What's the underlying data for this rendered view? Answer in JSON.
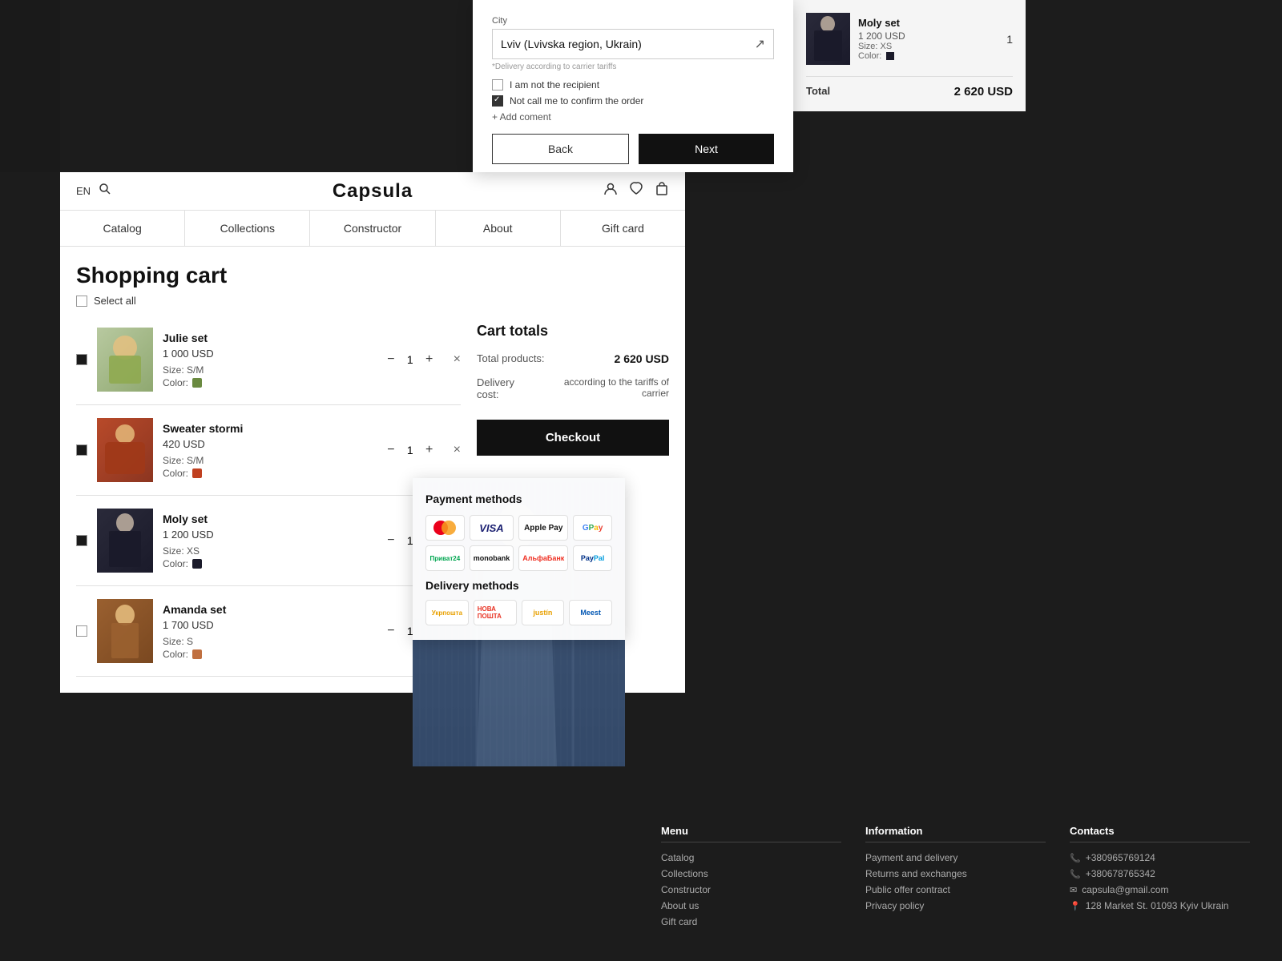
{
  "brand": "Capsula",
  "header": {
    "lang": "EN",
    "nav": [
      {
        "label": "Catalog"
      },
      {
        "label": "Collections"
      },
      {
        "label": "Constructor"
      },
      {
        "label": "About"
      },
      {
        "label": "Gift card"
      }
    ]
  },
  "page": {
    "title": "Shopping cart",
    "select_all": "Select all"
  },
  "cart_items": [
    {
      "name": "Julie set",
      "price": "1 000 USD",
      "size": "Size: S/M",
      "color_label": "Color:",
      "color": "#6a8a40",
      "qty": "1",
      "checked": true,
      "img_class": "cart-item-img-green"
    },
    {
      "name": "Sweater stormi",
      "price": "420 USD",
      "size": "Size: S/M",
      "color_label": "Color:",
      "color": "#c04020",
      "qty": "1",
      "checked": true,
      "img_class": "cart-item-img-rust"
    },
    {
      "name": "Moly set",
      "price": "1 200 USD",
      "size": "Size: XS",
      "color_label": "Color:",
      "color": "#1a1a2a",
      "qty": "1",
      "checked": true,
      "img_class": "cart-item-img-dark"
    },
    {
      "name": "Amanda set",
      "price": "1 700 USD",
      "size": "Size: S",
      "color_label": "Color:",
      "color": "#c07040",
      "qty": "1",
      "checked": false,
      "img_class": "cart-item-img-brown"
    }
  ],
  "cart_totals": {
    "title": "Cart totals",
    "total_products_label": "Total products:",
    "total_products_value": "2 620 USD",
    "delivery_label": "Delivery cost:",
    "delivery_value": "according to the tariffs of carrier",
    "checkout_btn": "Checkout"
  },
  "checkout_form": {
    "city_label": "City",
    "city_value": "Lviv (Lvivska region, Ukrain)",
    "delivery_note": "*Delivery according to carrier tariffs",
    "checkbox1": "I am not the recipient",
    "checkbox2": "Not call me to confirm the order",
    "add_comment": "+ Add coment",
    "back_btn": "Back",
    "next_btn": "Next"
  },
  "order_summary": {
    "item_name": "Moly set",
    "item_price": "1 200 USD",
    "item_size": "Size: XS",
    "item_color": "Color:",
    "item_qty": "1",
    "total_label": "Total",
    "total_value": "2 620 USD"
  },
  "footer": {
    "menu_title": "Menu",
    "menu_items": [
      "Catalog",
      "Collections",
      "Constructor",
      "About us",
      "Gift card"
    ],
    "info_title": "Information",
    "info_items": [
      "Payment and delivery",
      "Returns and exchanges",
      "Public offer contract",
      "Privacy policy"
    ],
    "contacts_title": "Contacts",
    "phone1": "+380965769124",
    "phone2": "+380678765342",
    "email": "capsula@gmail.com",
    "address": "128 Market St. 01093 Kyiv Ukrain"
  },
  "payment": {
    "title": "Payment methods",
    "methods": [
      "Mastercard",
      "VISA",
      "Apple Pay",
      "Google Pay",
      "Privat24",
      "monobank",
      "Alfa Bank",
      "PayPal"
    ]
  },
  "delivery": {
    "title": "Delivery methods",
    "methods": [
      "Укрпошта",
      "Нова Пошта",
      "Justin",
      "Meest"
    ]
  }
}
